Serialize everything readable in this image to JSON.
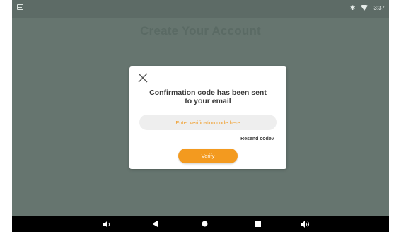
{
  "status_bar": {
    "left_icon": "image-notification-icon",
    "bluetooth_icon": "bluetooth-icon",
    "wifi_icon": "wifi-icon",
    "time": "3:37"
  },
  "background": {
    "title": "Create Your Account"
  },
  "dialog": {
    "close_icon": "close-icon",
    "message": "Confirmation code has been sent to your email",
    "code_input": {
      "placeholder": "Enter verification code here",
      "value": ""
    },
    "resend_label": "Resend code?",
    "verify_label": "Verify"
  },
  "nav_bar": {
    "items": [
      "volume-down-icon",
      "back-icon",
      "home-icon",
      "recents-icon",
      "volume-up-icon"
    ]
  },
  "colors": {
    "accent": "#f39a1f",
    "placeholder": "#f0a030",
    "overlay": "#66756f"
  }
}
